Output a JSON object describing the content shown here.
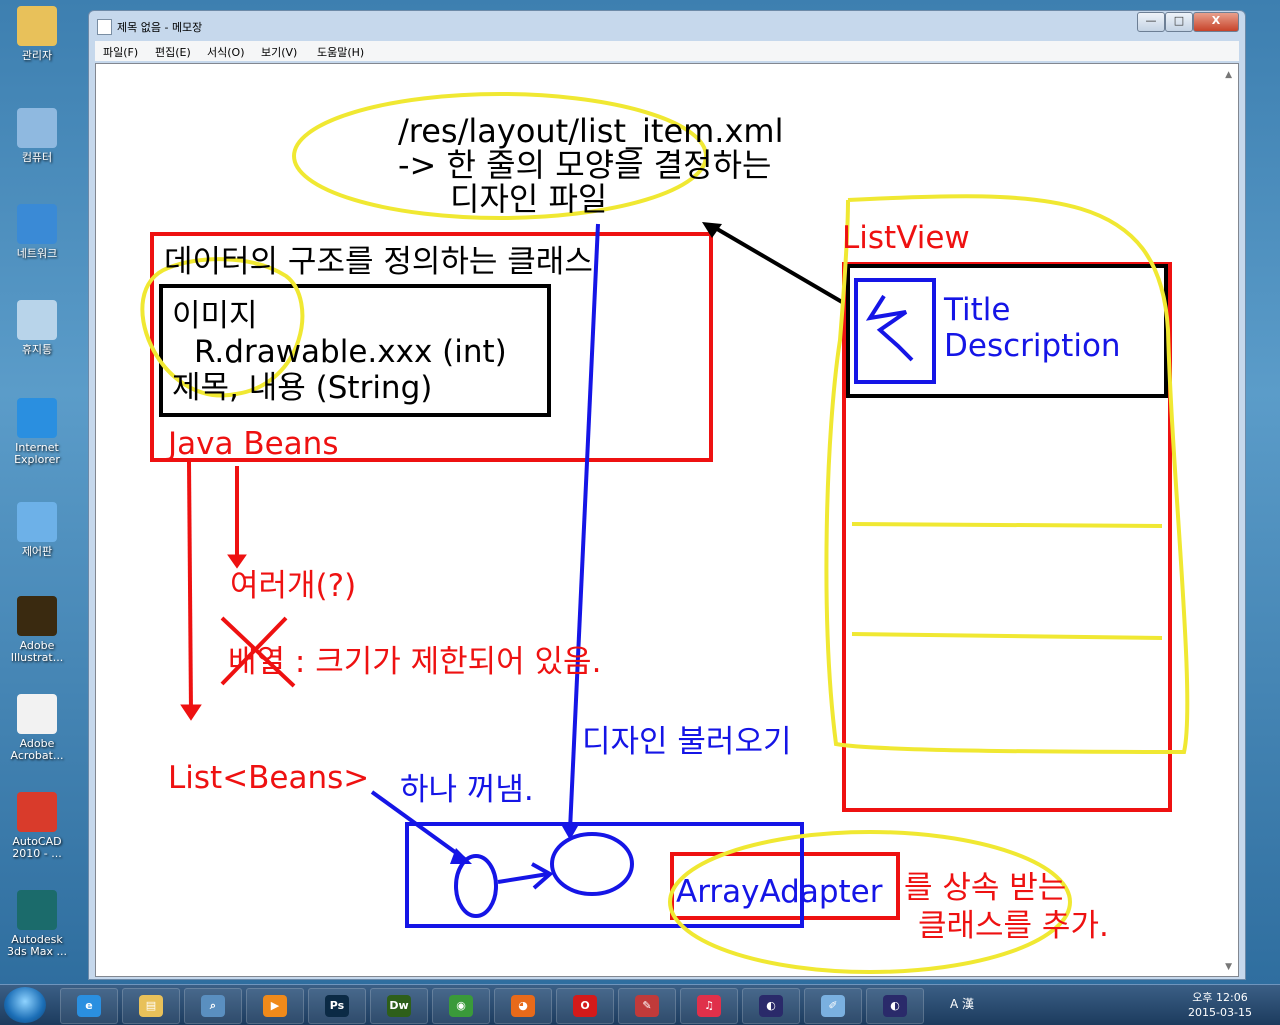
{
  "desktop": {
    "icons": [
      {
        "label": "관리자",
        "color": "#e8c15a"
      },
      {
        "label": "컴퓨터",
        "color": "#8fb9e0"
      },
      {
        "label": "네트워크",
        "color": "#3a8ad6"
      },
      {
        "label": "휴지통",
        "color": "#b8d4ea"
      },
      {
        "label": "Internet Explorer",
        "color": "#2a8fe0"
      },
      {
        "label": "제어판",
        "color": "#6db1e8"
      },
      {
        "label": "Adobe Illustrat...",
        "color": "#3a2a10"
      },
      {
        "label": "Adobe Acrobat...",
        "color": "#f2f2f2"
      },
      {
        "label": "AutoCAD 2010 - ...",
        "color": "#d93b2b"
      },
      {
        "label": "Autodesk 3ds Max ...",
        "color": "#1b6b6b"
      }
    ]
  },
  "window": {
    "title": "제목 없음 - 메모장",
    "buttons": {
      "minimize": "—",
      "maximize": "□",
      "close": "X"
    },
    "menu": [
      "파일(F)",
      "편집(E)",
      "서식(O)",
      "보기(V)",
      "도움말(H)"
    ]
  },
  "sketch": {
    "layout_file_line1": "/res/layout/list_item.xml",
    "layout_file_line2": "-> 한 줄의 모양을 결정하는",
    "layout_file_line3": "디자인 파일",
    "class_title": "데이터의 구조를 정의하는 클래스",
    "field_image": "이미지",
    "field_drawable": "R.drawable.xxx (int)",
    "field_text": "제목, 내용 (String)",
    "java_beans": "Java Beans",
    "many": "여러개(?)",
    "array_note": "배열 : 크기가 제한되어 있음.",
    "list_beans": "List<Beans>",
    "take_one": "하나 꺼냄.",
    "load_design": "디자인 불러오기",
    "listview": "ListView",
    "item_title": "Title",
    "item_desc": "Description",
    "array_adapter": "ArrayAdapter",
    "inherit_line1": "를 상속 받는",
    "inherit_line2": "클래스를 추가.",
    "colors": {
      "red": "#ee1111",
      "blue": "#1515e6",
      "black": "#000000",
      "yellow": "#f0e832"
    }
  },
  "taskbar": {
    "apps": [
      {
        "name": "ie",
        "glyph": "e",
        "color": "#2a8fe0"
      },
      {
        "name": "explorer",
        "glyph": "▤",
        "color": "#e8c15a"
      },
      {
        "name": "search",
        "glyph": "⌕",
        "color": "#5a8fc0"
      },
      {
        "name": "media",
        "glyph": "▶",
        "color": "#f08a1a"
      },
      {
        "name": "photoshop",
        "glyph": "Ps",
        "color": "#0b2a45"
      },
      {
        "name": "dreamweaver",
        "glyph": "Dw",
        "color": "#2e5f1a"
      },
      {
        "name": "chrome",
        "glyph": "◉",
        "color": "#3a9a3a"
      },
      {
        "name": "firefox",
        "glyph": "◕",
        "color": "#e86a1a"
      },
      {
        "name": "opera",
        "glyph": "O",
        "color": "#d41a1a"
      },
      {
        "name": "paint",
        "glyph": "✎",
        "color": "#c03a3a"
      },
      {
        "name": "itunes",
        "glyph": "♫",
        "color": "#e0304a"
      },
      {
        "name": "eclipse",
        "glyph": "◐",
        "color": "#2a2a6a"
      },
      {
        "name": "notepad",
        "glyph": "✐",
        "color": "#7ab0e0"
      },
      {
        "name": "eclipse2",
        "glyph": "◐",
        "color": "#2a2a6a"
      }
    ],
    "tray_text": "A 漢",
    "clock_time": "오후 12:06",
    "clock_date": "2015-03-15"
  }
}
